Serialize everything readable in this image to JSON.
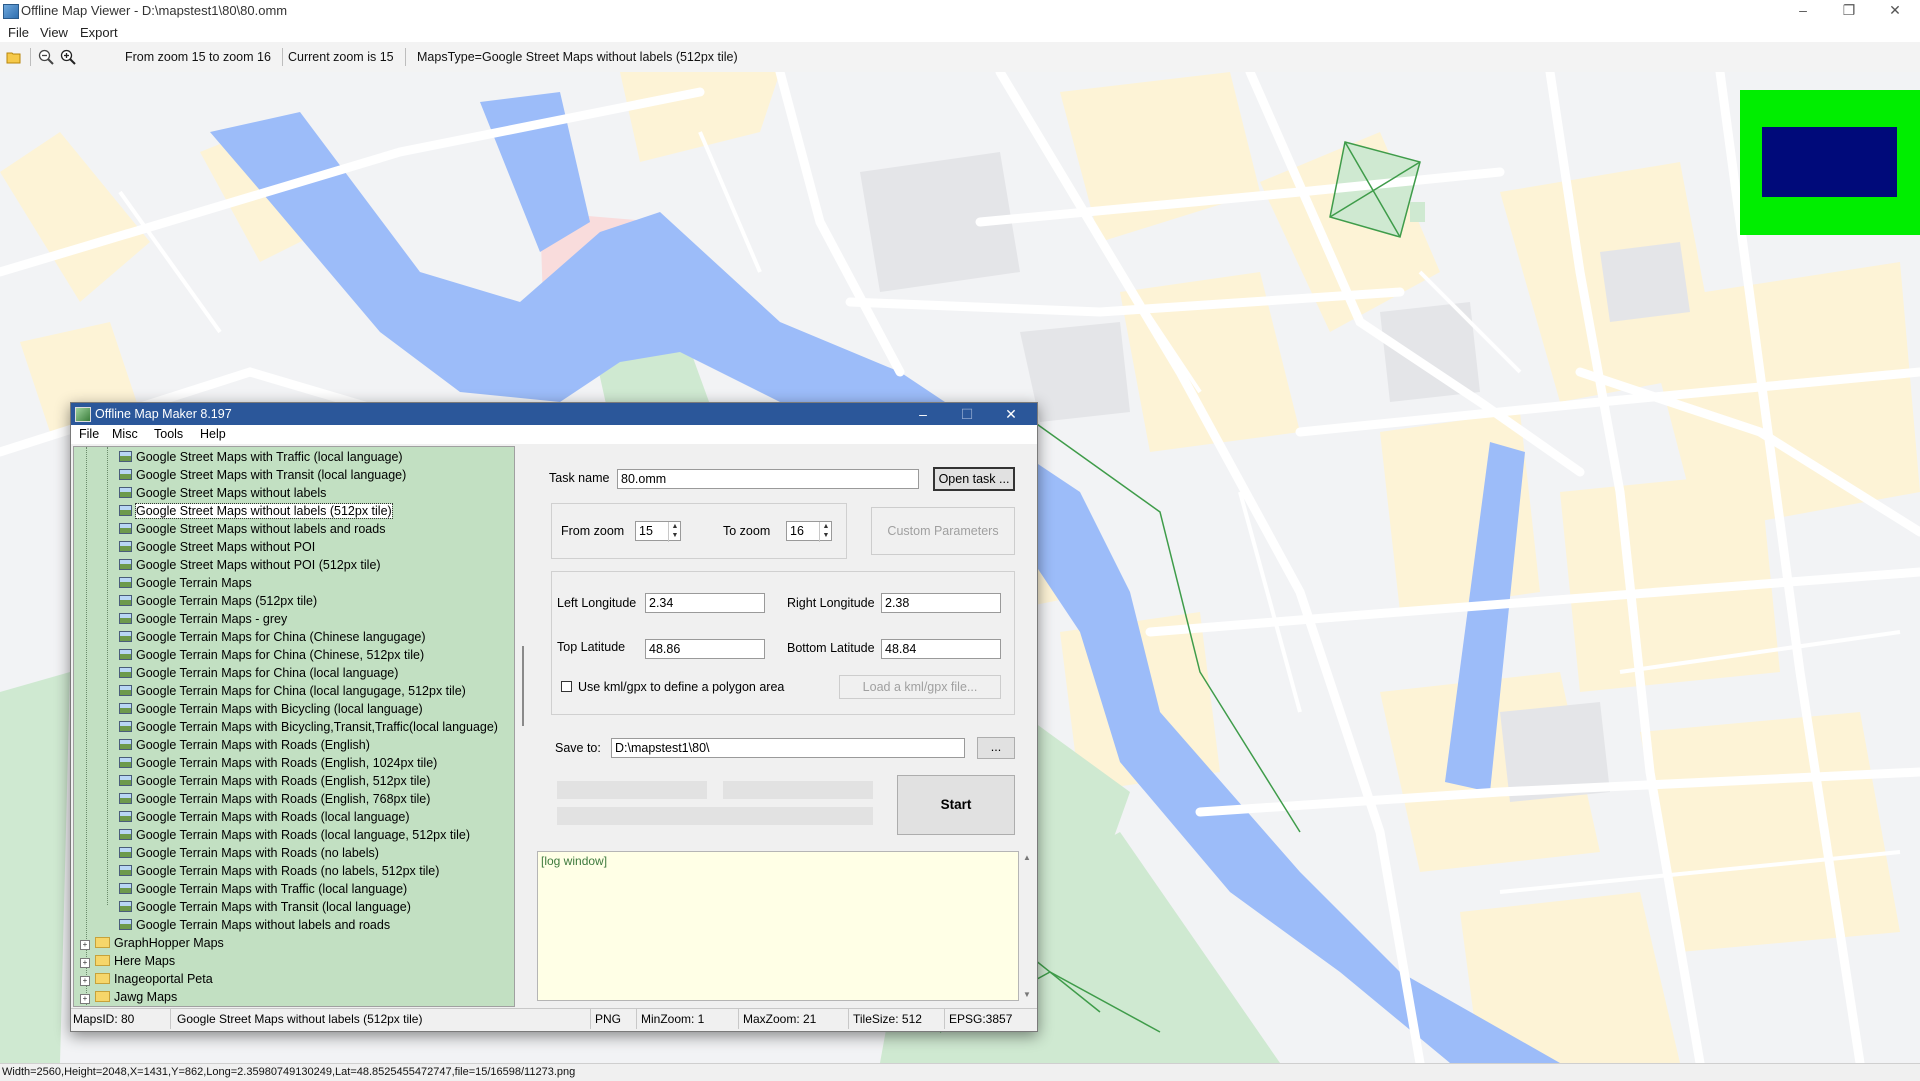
{
  "main_window": {
    "title": "Offline Map Viewer - D:\\mapstest1\\80\\80.omm",
    "menu": [
      "File",
      "View",
      "Export"
    ],
    "toolbar": {
      "zoom_range": "From zoom 15 to zoom 16",
      "current_zoom": "Current zoom is 15",
      "maps_type": "MapsType=Google Street Maps without labels (512px tile)"
    },
    "status": "Width=2560,Height=2048,X=1431,Y=862,Long=2.35980749130249,Lat=48.8525455472747,file=15/16598/11273.png"
  },
  "colors": {
    "overview_bg": "#00ee00",
    "overview_rect": "#000a7a",
    "tree_bg": "#c2e0c2",
    "dialog_title_bg": "#2b579a",
    "log_bg": "#ffffe6",
    "river": "#9cbcf9",
    "park": "#d3ecd5"
  },
  "dialog": {
    "title": "Offline Map Maker 8.197",
    "menu": [
      "File",
      "Misc",
      "Tools",
      "Help"
    ],
    "tree": {
      "items": [
        "Google Street Maps with Traffic (local language)",
        "Google Street Maps with Transit (local language)",
        "Google Street Maps without labels",
        "Google Street Maps without labels (512px tile)",
        "Google Street Maps without labels and roads",
        "Google Street Maps without POI",
        "Google Street Maps without POI (512px tile)",
        "Google Terrain Maps",
        "Google Terrain Maps (512px tile)",
        "Google Terrain Maps - grey",
        "Google Terrain Maps for China (Chinese langugage)",
        "Google Terrain Maps for China (Chinese, 512px tile)",
        "Google Terrain Maps for China (local language)",
        "Google Terrain Maps for China (local langugage, 512px tile)",
        "Google Terrain Maps with Bicycling (local language)",
        "Google Terrain Maps with Bicycling,Transit,Traffic(local language)",
        "Google Terrain Maps with Roads (English)",
        "Google Terrain Maps with Roads (English, 1024px tile)",
        "Google Terrain Maps with Roads (English, 512px tile)",
        "Google Terrain Maps with Roads (English, 768px tile)",
        "Google Terrain Maps with Roads (local language)",
        "Google Terrain Maps with Roads (local language, 512px tile)",
        "Google Terrain Maps with Roads (no labels)",
        "Google Terrain Maps with Roads (no labels, 512px tile)",
        "Google Terrain Maps with Traffic (local language)",
        "Google Terrain Maps with Transit (local language)",
        "Google Terrain Maps without labels and roads"
      ],
      "selected": "Google Street Maps without labels (512px tile)",
      "folders": [
        "GraphHopper Maps",
        "Here Maps",
        "Inageoportal Peta",
        "Jawg Maps"
      ]
    },
    "task_name_label": "Task name",
    "task_name": "80.omm",
    "open_task": "Open task ...",
    "from_zoom_label": "From zoom",
    "from_zoom": "15",
    "to_zoom_label": "To zoom",
    "to_zoom": "16",
    "custom_params": "Custom Parameters",
    "left_lon_label": "Left Longitude",
    "left_lon": "2.34",
    "right_lon_label": "Right Longitude",
    "right_lon": "2.38",
    "top_lat_label": "Top Latitude",
    "top_lat": "48.86",
    "bottom_lat_label": "Bottom Latitude",
    "bottom_lat": "48.84",
    "kml_label": "Use kml/gpx to define a polygon area",
    "kml_checked": false,
    "load_kml": "Load a kml/gpx file...",
    "save_to_label": "Save to:",
    "save_to": "D:\\mapstest1\\80\\",
    "browse": "...",
    "start": "Start",
    "log": "[log window]",
    "status": {
      "maps_id": "MapsID: 80",
      "maps_name": "Google Street Maps without labels (512px tile)",
      "format": "PNG",
      "min_zoom": "MinZoom: 1",
      "max_zoom": "MaxZoom: 21",
      "tile_size": "TileSize: 512",
      "epsg": "EPSG:3857"
    }
  }
}
